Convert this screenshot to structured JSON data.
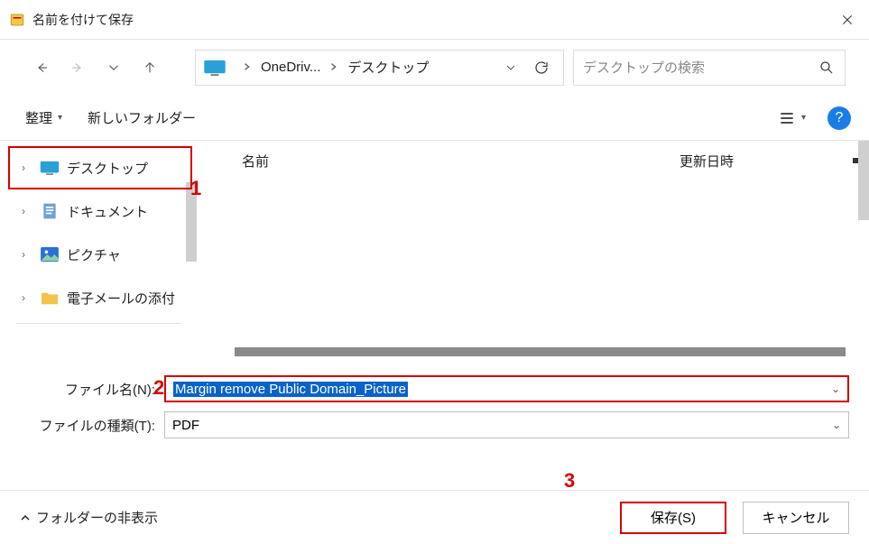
{
  "window": {
    "title": "名前を付けて保存"
  },
  "breadcrumb": {
    "part1": "OneDriv...",
    "part2": "デスクトップ"
  },
  "search": {
    "placeholder": "デスクトップの検索"
  },
  "toolbar": {
    "organize": "整理",
    "new_folder": "新しいフォルダー"
  },
  "tree": {
    "items": [
      {
        "label": "デスクトップ"
      },
      {
        "label": "ドキュメント"
      },
      {
        "label": "ピクチャ"
      },
      {
        "label": "電子メールの添付"
      }
    ]
  },
  "columns": {
    "name": "名前",
    "date": "更新日時"
  },
  "fields": {
    "filename_label": "ファイル名(N):",
    "filename_value": "Margin remove Public Domain_Picture",
    "filetype_label": "ファイルの種類(T):",
    "filetype_value": "PDF"
  },
  "bottom": {
    "hide_folders": "フォルダーの非表示",
    "save": "保存(S)",
    "cancel": "キャンセル"
  },
  "annotations": {
    "n1": "1",
    "n2": "2",
    "n3": "3"
  }
}
